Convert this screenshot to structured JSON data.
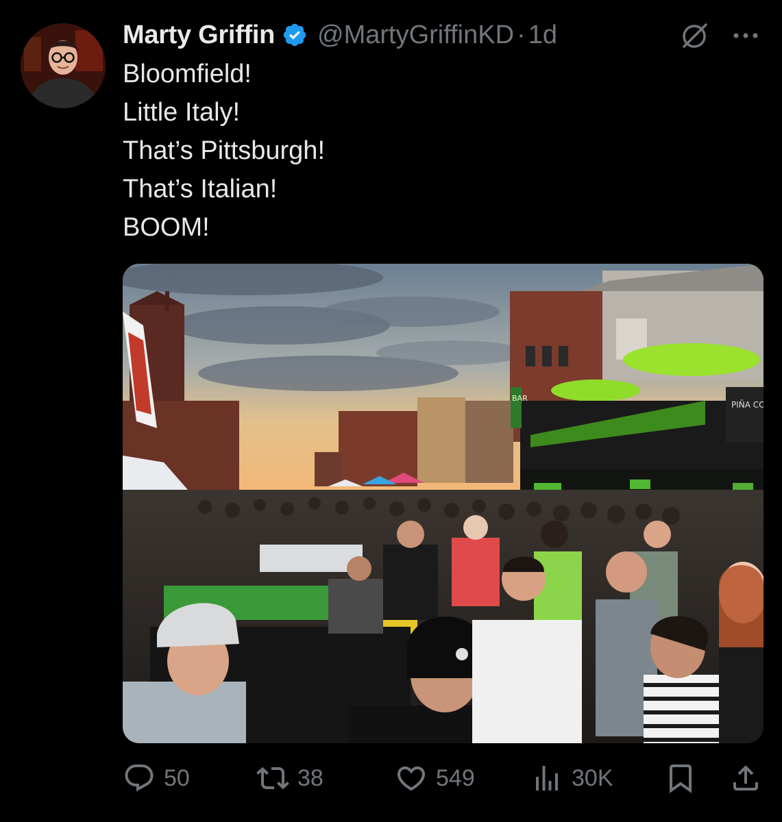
{
  "author": {
    "display_name": "Marty Griffin",
    "handle": "@MartyGriffinKD",
    "separator": "·",
    "timestamp": "1d",
    "verified": true,
    "verified_color": "#1d9bf0"
  },
  "header_icons": {
    "grok": "grok-icon",
    "more": "more-icon"
  },
  "tweet": {
    "lines": [
      "Bloomfield!",
      "Little Italy!",
      "That’s Pittsburgh!",
      "That’s Italian!",
      "BOOM!"
    ]
  },
  "media": {
    "signs": {
      "piña_coladas": "PIÑA COLADAS",
      "bar": "BAR"
    }
  },
  "actions": {
    "reply": {
      "icon": "reply-icon",
      "count": "50"
    },
    "retweet": {
      "icon": "retweet-icon",
      "count": "38"
    },
    "like": {
      "icon": "heart-icon",
      "count": "549"
    },
    "views": {
      "icon": "views-icon",
      "count": "30K"
    },
    "bookmark": {
      "icon": "bookmark-icon"
    },
    "share": {
      "icon": "share-icon"
    }
  },
  "colors": {
    "background": "#000000",
    "text": "#e7e9ea",
    "muted": "#71767b"
  }
}
